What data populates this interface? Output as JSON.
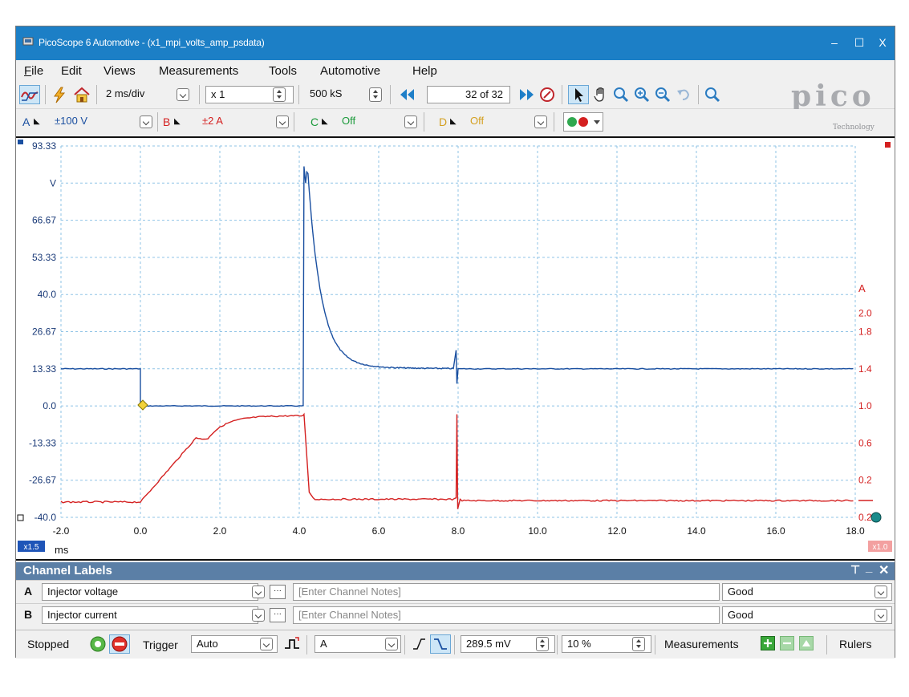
{
  "window": {
    "title": "PicoScope 6 Automotive - (x1_mpi_volts_amp_psdata)"
  },
  "menu": [
    "File",
    "Edit",
    "Views",
    "Measurements",
    "Tools",
    "Automotive",
    "Help"
  ],
  "menu_underline": [
    "F",
    "E",
    "V",
    "M",
    "T",
    "",
    "H"
  ],
  "toolbar": {
    "timebase": "2 ms/div",
    "zoom": "x 1",
    "samples": "500 kS",
    "buffer": "32 of 32",
    "brand": "pico",
    "brand_sub": "Technology"
  },
  "channels": [
    {
      "letter": "A",
      "range": "±100 V",
      "color": "#1a4fa0"
    },
    {
      "letter": "B",
      "range": "±2 A",
      "color": "#d42020"
    },
    {
      "letter": "C",
      "range": "Off",
      "color": "#1a9a3a"
    },
    {
      "letter": "D",
      "range": "Off",
      "color": "#d4a020"
    }
  ],
  "plot": {
    "left_axis_ticks": [
      "93.33",
      "V",
      "66.67",
      "53.33",
      "40.0",
      "26.67",
      "13.33",
      "0.0",
      "-13.33",
      "-26.67",
      "-40.0"
    ],
    "right_axis_unit": "A",
    "right_axis_ticks": [
      "2.0",
      "1.8",
      "1.4",
      "1.0",
      "0.6",
      "0.2",
      "0.2"
    ],
    "x_ticks": [
      "-2.0",
      "0.0",
      "2.0",
      "4.0",
      "6.0",
      "8.0",
      "10.0",
      "12.0",
      "14.0",
      "16.0",
      "18.0"
    ],
    "x_unit": "ms",
    "left_zoom_badge": "x1.5",
    "right_zoom_badge": "x1.0",
    "colors": {
      "channel_a": "#1a4fa0",
      "channel_b": "#d42020",
      "grid": "#8fc3e6"
    }
  },
  "channel_labels": {
    "title": "Channel Labels",
    "rows": [
      {
        "letter": "A",
        "name": "Injector voltage",
        "notes_placeholder": "[Enter Channel Notes]",
        "status": "Good"
      },
      {
        "letter": "B",
        "name": "Injector current",
        "notes_placeholder": "[Enter Channel Notes]",
        "status": "Good"
      }
    ]
  },
  "status": {
    "state": "Stopped",
    "trigger_label": "Trigger",
    "trigger_mode": "Auto",
    "trigger_channel": "A",
    "trigger_level": "289.5 mV",
    "pre_trigger": "10 %",
    "measurements_label": "Measurements",
    "rulers_label": "Rulers"
  }
}
